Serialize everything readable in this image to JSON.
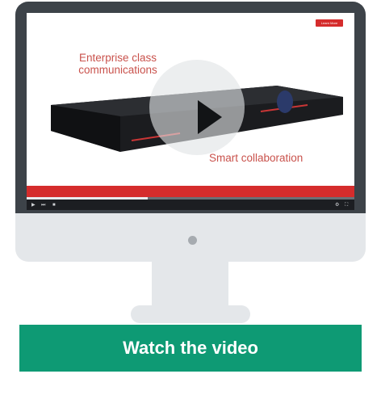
{
  "video": {
    "badge_text": "Learn More",
    "headline_line1": "Enterprise class",
    "headline_line2": "communications",
    "tagline": "Smart collaboration",
    "progress_fraction": 0.37,
    "play_icon": "play-icon"
  },
  "cta": {
    "label": "Watch the video"
  },
  "colors": {
    "accent_green": "#0e9a74",
    "brand_red": "#d52c2c",
    "text_red": "#c9524c",
    "bezel": "#3d4349",
    "monitor_body": "#e4e7ea"
  }
}
